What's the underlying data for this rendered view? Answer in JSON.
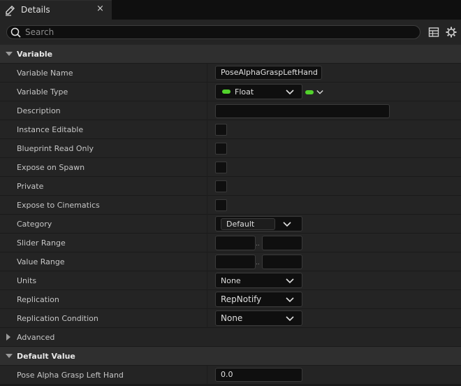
{
  "tab": {
    "title": "Details",
    "close": "×"
  },
  "search": {
    "placeholder": "Search"
  },
  "sections": {
    "variable": "Variable",
    "advanced": "Advanced",
    "default_value": "Default Value"
  },
  "props": {
    "variable_name": {
      "label": "Variable Name",
      "value": "PoseAlphaGraspLeftHand"
    },
    "variable_type": {
      "label": "Variable Type",
      "value": "Float",
      "pin_color": "#52d22c"
    },
    "description": {
      "label": "Description",
      "value": ""
    },
    "instance_editable": {
      "label": "Instance Editable"
    },
    "blueprint_read_only": {
      "label": "Blueprint Read Only"
    },
    "expose_on_spawn": {
      "label": "Expose on Spawn"
    },
    "private": {
      "label": "Private"
    },
    "expose_to_cinematics": {
      "label": "Expose to Cinematics"
    },
    "category": {
      "label": "Category",
      "value": "Default"
    },
    "slider_range": {
      "label": "Slider Range",
      "sep": ".."
    },
    "value_range": {
      "label": "Value Range",
      "sep": ".."
    },
    "units": {
      "label": "Units",
      "value": "None"
    },
    "replication": {
      "label": "Replication",
      "value": "RepNotify"
    },
    "replication_condition": {
      "label": "Replication Condition",
      "value": "None"
    },
    "pose_alpha": {
      "label": "Pose Alpha Grasp Left Hand",
      "value": "0.0"
    }
  },
  "icons": {
    "tab": "pencil-icon",
    "search": "search-icon",
    "table": "table-icon",
    "settings": "gear-icon"
  }
}
